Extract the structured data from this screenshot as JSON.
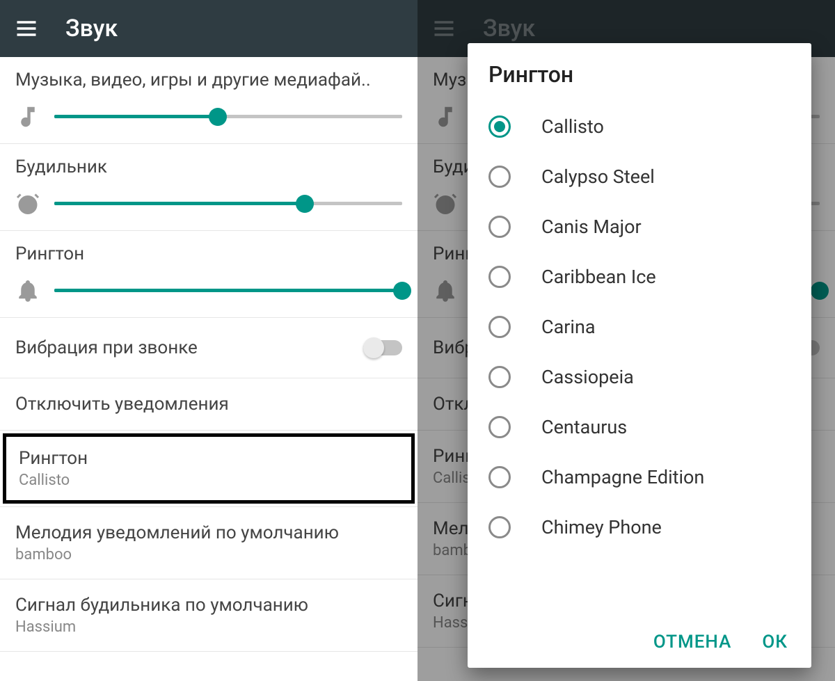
{
  "appbar": {
    "title": "Звук"
  },
  "sliders": {
    "media": {
      "label": "Музыка, видео, игры и другие медиафай..",
      "value": 47
    },
    "alarm": {
      "label": "Будильник",
      "value": 72
    },
    "ring": {
      "label": "Рингтон",
      "value": 100
    }
  },
  "toggles": {
    "vibrate": {
      "label": "Вибрация при звонке",
      "on": false
    }
  },
  "items": {
    "disableNotif": {
      "title": "Отключить уведомления"
    },
    "ringtone": {
      "title": "Рингтон",
      "sub": "Callisto"
    },
    "notifSound": {
      "title": "Мелодия уведомлений по умолчанию",
      "sub": "bamboo"
    },
    "alarmSound": {
      "title": "Сигнал будильника по умолчанию",
      "sub": "Hassium"
    }
  },
  "dialog": {
    "title": "Рингтон",
    "options": [
      {
        "label": "Callisto",
        "checked": true
      },
      {
        "label": "Calypso Steel",
        "checked": false
      },
      {
        "label": "Canis Major",
        "checked": false
      },
      {
        "label": "Caribbean Ice",
        "checked": false
      },
      {
        "label": "Carina",
        "checked": false
      },
      {
        "label": "Cassiopeia",
        "checked": false
      },
      {
        "label": "Centaurus",
        "checked": false
      },
      {
        "label": "Champagne Edition",
        "checked": false
      },
      {
        "label": "Chimey Phone",
        "checked": false
      }
    ],
    "cancel": "ОТМЕНА",
    "ok": "ОК"
  }
}
